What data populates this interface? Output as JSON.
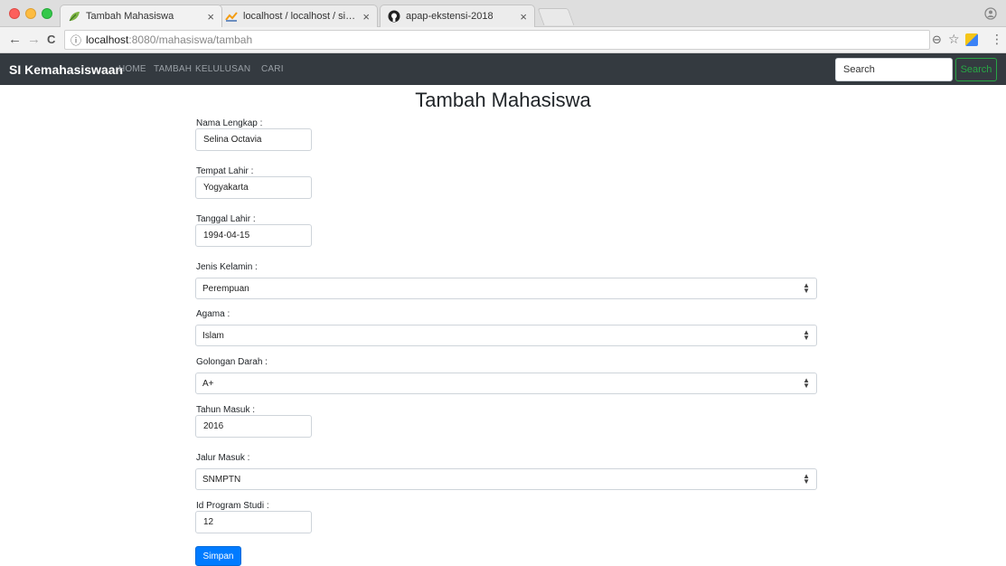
{
  "browser": {
    "tabs": [
      {
        "title": "Tambah Mahasiswa",
        "icon": "leaf-icon",
        "close": "×",
        "active": true
      },
      {
        "title": "localhost / localhost / si_kemal",
        "icon": "phpmyadmin-icon",
        "close": "×",
        "active": false
      },
      {
        "title": "apap-ekstensi-2018",
        "icon": "github-icon",
        "close": "×",
        "active": false
      }
    ],
    "profile_icon": "profile-icon",
    "nav": {
      "back": "←",
      "forward": "→",
      "reload": "C"
    },
    "url": {
      "info": "ⓘ",
      "host": "localhost",
      "path": ":8080/mahasiswa/tambah"
    },
    "toolbar_icons": {
      "zoom": "⊖",
      "star": "☆",
      "menu": "⋮"
    }
  },
  "navbar": {
    "brand": "SI Kemahasiswaan",
    "links": [
      "HOME",
      "TAMBAH",
      "KELULUSAN",
      "CARI"
    ],
    "search_placeholder": "Search",
    "search_button": "Search"
  },
  "form": {
    "title": "Tambah Mahasiswa",
    "fields": {
      "nama": {
        "label": "Nama Lengkap :",
        "value": "Selina Octavia"
      },
      "tempat": {
        "label": "Tempat Lahir :",
        "value": "Yogyakarta"
      },
      "tanggal": {
        "label": "Tanggal Lahir :",
        "value": "1994-04-15"
      },
      "jenis_kelamin": {
        "label": "Jenis Kelamin :",
        "value": "Perempuan"
      },
      "agama": {
        "label": "Agama :",
        "value": "Islam"
      },
      "golongan_darah": {
        "label": "Golongan Darah :",
        "value": "A+"
      },
      "tahun_masuk": {
        "label": "Tahun Masuk :",
        "value": "2016"
      },
      "jalur_masuk": {
        "label": "Jalur Masuk :",
        "value": "SNMPTN"
      },
      "id_prodi": {
        "label": "Id Program Studi :",
        "value": "12"
      }
    },
    "submit": "Simpan"
  },
  "colors": {
    "navbar_bg": "#343a40",
    "primary": "#007bff",
    "success": "#28a745"
  }
}
